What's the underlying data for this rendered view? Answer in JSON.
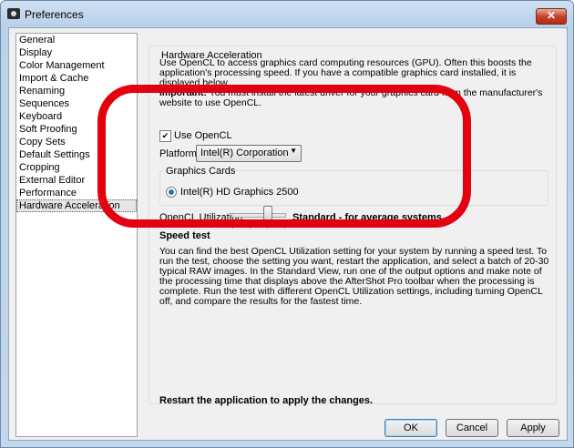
{
  "window": {
    "title": "Preferences",
    "close_symbol": "✕"
  },
  "sidebar": {
    "items": [
      {
        "label": "General"
      },
      {
        "label": "Display"
      },
      {
        "label": "Color Management"
      },
      {
        "label": "Import & Cache"
      },
      {
        "label": "Renaming"
      },
      {
        "label": "Sequences"
      },
      {
        "label": "Keyboard"
      },
      {
        "label": "Soft Proofing"
      },
      {
        "label": "Copy Sets"
      },
      {
        "label": "Default Settings"
      },
      {
        "label": "Cropping"
      },
      {
        "label": "External Editor"
      },
      {
        "label": "Performance"
      },
      {
        "label": "Hardware Acceleration",
        "selected": true
      }
    ]
  },
  "panel": {
    "group_title": "Hardware Acceleration",
    "intro": "Use OpenCL to access graphics card computing resources (GPU). Often this boosts the application's processing speed. If you have a compatible graphics card installed, it is displayed below.",
    "important_label": "Important:",
    "important_text": " You must install the latest driver for your graphics card from the manufacturer's website to use OpenCL.",
    "use_opencl_label": "Use OpenCL",
    "use_opencl_checked": true,
    "checkmark": "✔",
    "platform_label": "Platform",
    "platform_value": "Intel(R) Corporation",
    "dropdown_arrow": "▼",
    "graphics_cards_title": "Graphics Cards",
    "graphics_card_name": "Intel(R) HD Graphics 2500",
    "utilization_label": "OpenCL Utilization:",
    "utilization_value": "Standard - for average systems",
    "speed_test_title": "Speed test",
    "speed_test_text": "You can find the best OpenCL Utilization setting for your system by running a speed test. To run the test, choose the setting you want, restart the application, and select a batch of 20-30 typical RAW images. In the Standard View, run one of the output options and make note of the processing time that displays above the AfterShot Pro toolbar when the processing is complete. Run the test with different OpenCL Utilization settings, including turning OpenCL off, and compare the results for the fastest time.",
    "restart_note": "Restart the application to apply the changes."
  },
  "buttons": {
    "ok": "OK",
    "cancel": "Cancel",
    "apply": "Apply"
  },
  "colors": {
    "annotation": "#e3000f",
    "selection": "#e6e6e6"
  }
}
